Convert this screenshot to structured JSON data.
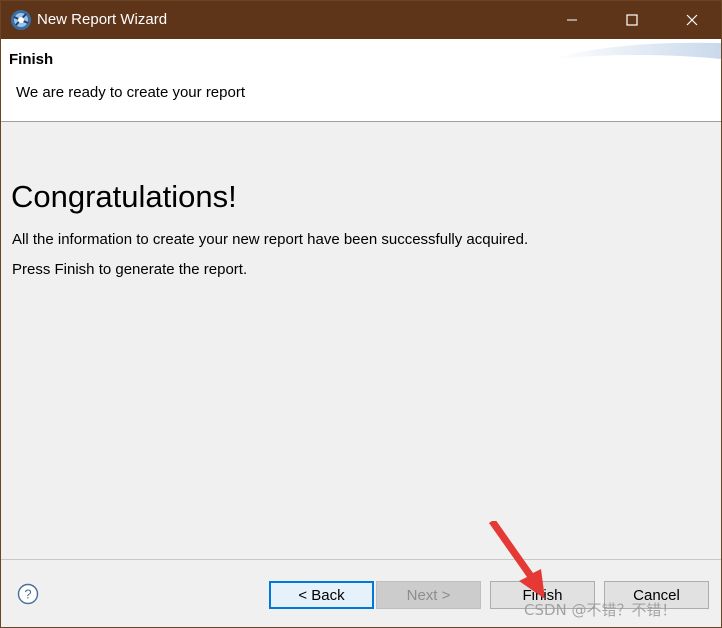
{
  "window": {
    "title": "New Report Wizard",
    "icons": {
      "app": "eclipse-birt-icon",
      "minimize": "minimize-icon",
      "maximize": "maximize-icon",
      "close": "close-icon"
    }
  },
  "banner": {
    "title": "Finish",
    "description": "We are ready to create your report"
  },
  "content": {
    "heading": "Congratulations!",
    "line1": "All the information to create your new report have been successfully acquired.",
    "line2": "Press Finish to generate the report."
  },
  "buttons": {
    "help_icon": "help-icon",
    "back": "< Back",
    "next": "Next >",
    "finish": "Finish",
    "cancel": "Cancel"
  },
  "watermark": "CSDN @不错？不错！",
  "colors": {
    "titlebar": "#5e3519",
    "arrow": "#e53935",
    "focus": "#0078d7"
  }
}
